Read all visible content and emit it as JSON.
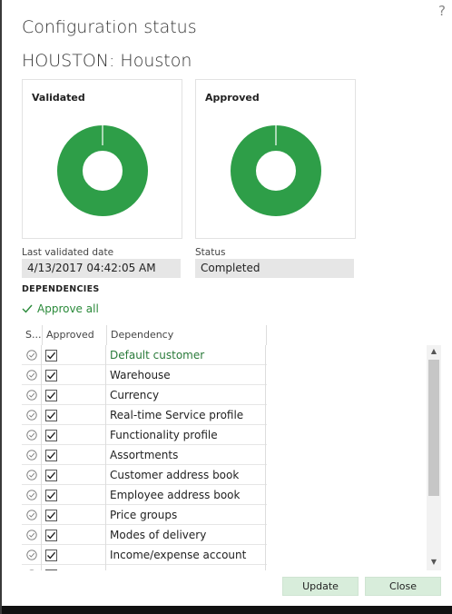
{
  "dialog": {
    "title": "Configuration status",
    "subtitle": "HOUSTON: Houston",
    "help_icon": "question-mark-icon"
  },
  "cards": [
    {
      "title": "Validated",
      "fraction": 1.0,
      "color": "#2e9e48"
    },
    {
      "title": "Approved",
      "fraction": 1.0,
      "color": "#2e9e48"
    }
  ],
  "fields": {
    "last_validated_label": "Last validated date",
    "last_validated_value": "4/13/2017 04:42:05 AM",
    "status_label": "Status",
    "status_value": "Completed"
  },
  "dependencies": {
    "heading": "DEPENDENCIES",
    "approve_all": "Approve all",
    "columns": [
      "S...",
      "Approved",
      "Dependency"
    ],
    "rows": [
      {
        "approved": true,
        "name": "Default customer"
      },
      {
        "approved": true,
        "name": "Warehouse"
      },
      {
        "approved": true,
        "name": "Currency"
      },
      {
        "approved": true,
        "name": "Real-time Service profile"
      },
      {
        "approved": true,
        "name": "Functionality profile"
      },
      {
        "approved": true,
        "name": "Assortments"
      },
      {
        "approved": true,
        "name": "Customer address book"
      },
      {
        "approved": true,
        "name": "Employee address book"
      },
      {
        "approved": true,
        "name": "Price groups"
      },
      {
        "approved": true,
        "name": "Modes of delivery"
      },
      {
        "approved": true,
        "name": "Income/expense account"
      },
      {
        "approved": true,
        "name": ""
      }
    ]
  },
  "buttons": {
    "update": "Update",
    "close": "Close"
  },
  "colors": {
    "accent_green": "#2e9e48",
    "button_bg": "#d8eddb"
  }
}
